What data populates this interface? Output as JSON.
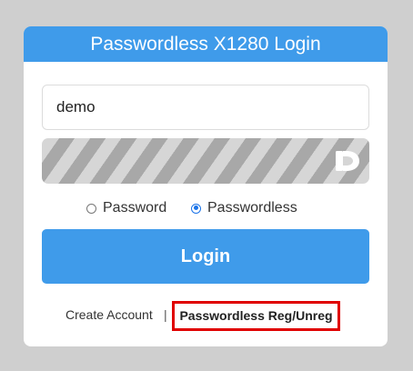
{
  "login": {
    "title": "Passwordless X1280 Login",
    "userid_value": "demo",
    "password_bar_icon": "passwordless-logo-icon",
    "radio_options": [
      {
        "label": "Password",
        "checked": false
      },
      {
        "label": "Passwordless",
        "checked": true
      }
    ],
    "login_label": "Login",
    "create_account_label": "Create Account",
    "separator": "|",
    "reg_unreg_label": "Passwordless Reg/Unreg"
  },
  "colors": {
    "accent": "#3f9bea",
    "highlight_box": "#e00000",
    "background": "#cfcfcf"
  }
}
